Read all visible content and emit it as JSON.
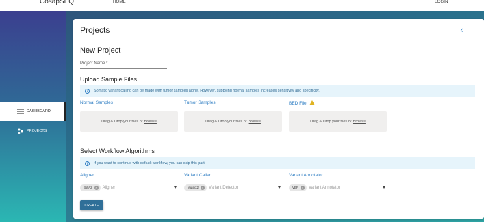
{
  "topbar": {
    "brand": "CosapSEQ",
    "home": "HOME",
    "login": "LOGIN"
  },
  "sidebar": {
    "items": [
      {
        "label": "DASHBOARD",
        "icon": "dashboard-icon",
        "active": true
      },
      {
        "label": "PROJECTS",
        "icon": "projects-icon",
        "active": false
      }
    ]
  },
  "card": {
    "title": "Projects",
    "back_icon": "chevron-left-icon",
    "new_project_heading": "New Project",
    "project_name_label": "Project Name *",
    "upload_heading": "Upload Sample Files",
    "upload_info": "Somatic variant calling can be made with tumor samples alone. However, suppying normal samples increases sensitivity and specificity.",
    "upload_columns": [
      {
        "label": "Normal Samples",
        "drop_text": "Drag & Drop your files or",
        "browse": "Browse"
      },
      {
        "label": "Tumor Samples",
        "drop_text": "Drag & Drop your files or",
        "browse": "Browse"
      },
      {
        "label": "BED File",
        "drop_text": "Drag & Drop your files or",
        "browse": "Browse",
        "icon": "warning-icon"
      }
    ],
    "workflow_heading": "Select Workflow Algorithms",
    "workflow_info": "If you want to continue with default workflow, you can skip this part.",
    "workflow_columns": [
      {
        "label": "Aligner",
        "chip": "BWA2",
        "placeholder": "Aligner"
      },
      {
        "label": "Variant Caller",
        "chip": "Mutect2",
        "placeholder": "Variant Detector"
      },
      {
        "label": "Variant Annotator",
        "chip": "VEP",
        "placeholder": "Variant Annotator"
      }
    ],
    "create_label": "CREATE"
  },
  "colors": {
    "accent": "#2f7ec3",
    "button": "#2f6f98",
    "info_bg": "#e6f4fb",
    "warning": "#e0b321"
  }
}
